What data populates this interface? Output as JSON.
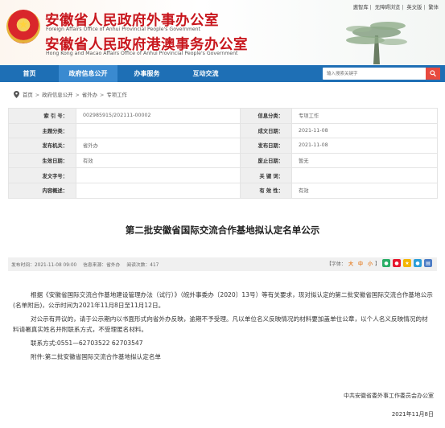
{
  "header": {
    "title_cn_1": "安徽省人民政府外事办公室",
    "title_en_1": "Foreign Affairs Office of Anhui Provincial People's Government",
    "title_cn_2": "安徽省人民政府港澳事务办公室",
    "title_en_2": "Hong Kong and Macao Affairs Office of Anhui Provincial People's Government",
    "top_links": [
      "邀智库",
      "无障碍浏览",
      "英文版",
      "繁体"
    ]
  },
  "nav": {
    "items": [
      "首页",
      "政府信息公开",
      "办事服务",
      "互动交流"
    ],
    "active_index": 1,
    "search_placeholder": "输入搜索关键字"
  },
  "breadcrumb": [
    "首页",
    "政府信息公开",
    "省外办",
    "专项工作"
  ],
  "info": {
    "rows": [
      [
        {
          "label": "索 引 号：",
          "value": "002985915/202111-00002"
        },
        {
          "label": "信息分类：",
          "value": "专项工作"
        }
      ],
      [
        {
          "label": "主题分类：",
          "value": ""
        },
        {
          "label": "成文日期：",
          "value": "2021-11-08"
        }
      ],
      [
        {
          "label": "发布机关：",
          "value": "省外办"
        },
        {
          "label": "发布日期：",
          "value": "2021-11-08"
        }
      ],
      [
        {
          "label": "生效日期：",
          "value": "有效"
        },
        {
          "label": "废止日期：",
          "value": "暂无"
        }
      ],
      [
        {
          "label": "发文字号：",
          "value": ""
        },
        {
          "label": "关 键 词：",
          "value": ""
        }
      ],
      [
        {
          "label": "内容概述：",
          "value": ""
        },
        {
          "label": "有 效 性：",
          "value": "有效"
        }
      ]
    ]
  },
  "article": {
    "title": "第二批安徽省国际交流合作基地拟认定名单公示",
    "meta": {
      "publish_time": "发布时间：2021-11-08 09:00",
      "source": "信息来源：省外办",
      "views": "阅读次数：417",
      "font_label": "【字体：",
      "font_sizes": [
        "大",
        "中",
        "小"
      ],
      "font_close": "】"
    },
    "paragraphs": [
      "根据《安徽省国际交流合作基地建设管理办法（试行）》（皖外事委办〔2020〕13号）等有关要求，现对拟认定的第二批安徽省国际交流合作基地公示(名单附后)，公示时间为2021年11月8日至11月12日。",
      "对公示有异议的，请于公示期内以书面形式向省外办反映，逾期不予受理。凡以单位名义反映情况的材料要加盖单位公章，以个人名义反映情况的材料请署真实姓名并附联系方式，不受理匿名材料。",
      "联系方式:0551—62703522  62703547",
      "附件:第二批安徽省国际交流合作基地拟认定名单"
    ],
    "signature_org": "中共安徽省委外事工作委员会办公室",
    "signature_date": "2021年11月8日"
  },
  "colors": {
    "brand_red": "#c8161d",
    "nav_blue": "#1e6fb5",
    "nav_active": "#3a8ad0",
    "search_red": "#e84a3f"
  }
}
